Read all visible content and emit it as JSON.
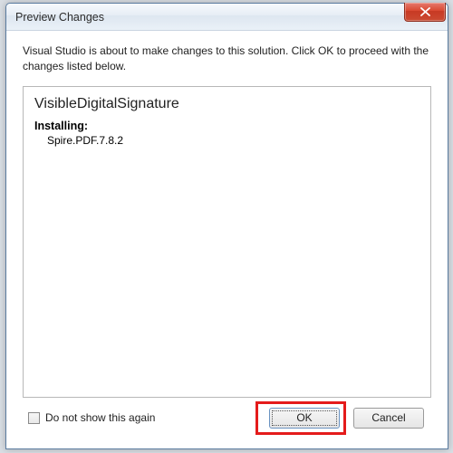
{
  "backdrop_hint": "NuGet Package Manager",
  "dialog": {
    "title": "Preview Changes",
    "message": "Visual Studio is about to make changes to this solution. Click OK to proceed with the changes listed below.",
    "project": "VisibleDigitalSignature",
    "action_heading": "Installing:",
    "items": [
      "Spire.PDF.7.8.2"
    ],
    "checkbox_label": "Do not show this again",
    "ok_label": "OK",
    "cancel_label": "Cancel"
  }
}
